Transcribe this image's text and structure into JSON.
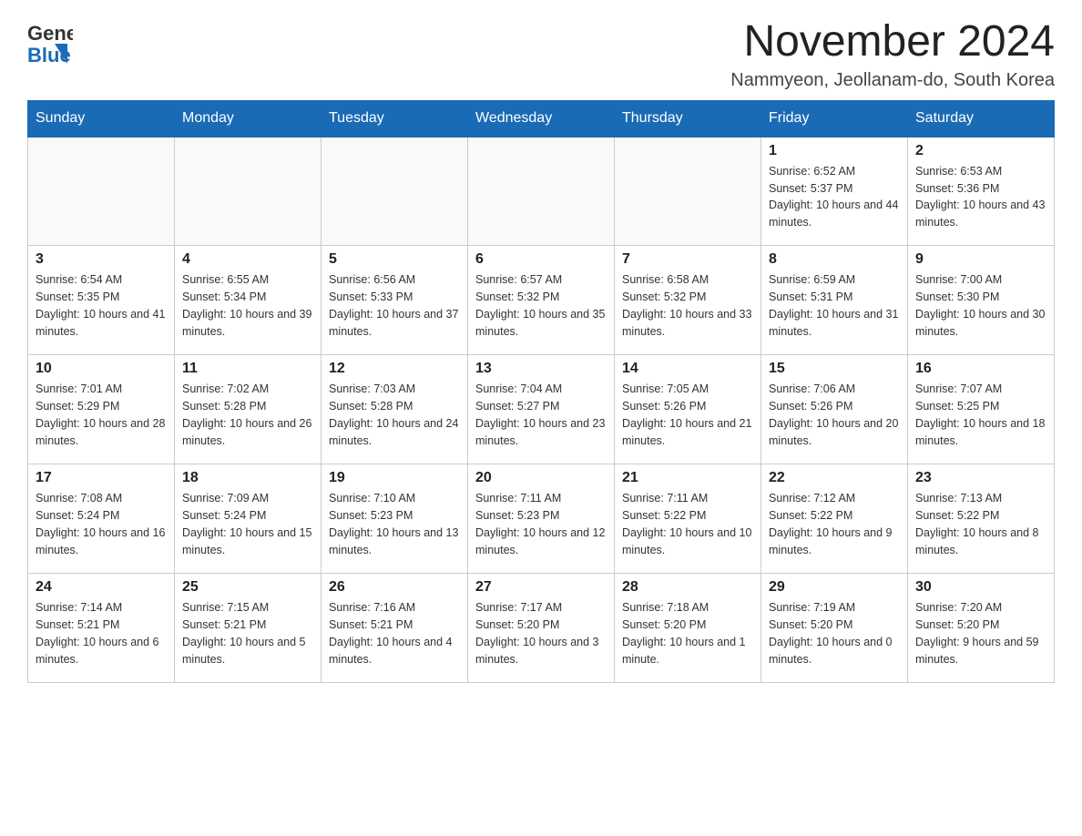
{
  "logo": {
    "general": "General",
    "blue": "Blue"
  },
  "header": {
    "month_title": "November 2024",
    "location": "Nammyeon, Jeollanam-do, South Korea"
  },
  "days_of_week": [
    "Sunday",
    "Monday",
    "Tuesday",
    "Wednesday",
    "Thursday",
    "Friday",
    "Saturday"
  ],
  "weeks": [
    [
      {
        "day": "",
        "info": ""
      },
      {
        "day": "",
        "info": ""
      },
      {
        "day": "",
        "info": ""
      },
      {
        "day": "",
        "info": ""
      },
      {
        "day": "",
        "info": ""
      },
      {
        "day": "1",
        "info": "Sunrise: 6:52 AM\nSunset: 5:37 PM\nDaylight: 10 hours and 44 minutes."
      },
      {
        "day": "2",
        "info": "Sunrise: 6:53 AM\nSunset: 5:36 PM\nDaylight: 10 hours and 43 minutes."
      }
    ],
    [
      {
        "day": "3",
        "info": "Sunrise: 6:54 AM\nSunset: 5:35 PM\nDaylight: 10 hours and 41 minutes."
      },
      {
        "day": "4",
        "info": "Sunrise: 6:55 AM\nSunset: 5:34 PM\nDaylight: 10 hours and 39 minutes."
      },
      {
        "day": "5",
        "info": "Sunrise: 6:56 AM\nSunset: 5:33 PM\nDaylight: 10 hours and 37 minutes."
      },
      {
        "day": "6",
        "info": "Sunrise: 6:57 AM\nSunset: 5:32 PM\nDaylight: 10 hours and 35 minutes."
      },
      {
        "day": "7",
        "info": "Sunrise: 6:58 AM\nSunset: 5:32 PM\nDaylight: 10 hours and 33 minutes."
      },
      {
        "day": "8",
        "info": "Sunrise: 6:59 AM\nSunset: 5:31 PM\nDaylight: 10 hours and 31 minutes."
      },
      {
        "day": "9",
        "info": "Sunrise: 7:00 AM\nSunset: 5:30 PM\nDaylight: 10 hours and 30 minutes."
      }
    ],
    [
      {
        "day": "10",
        "info": "Sunrise: 7:01 AM\nSunset: 5:29 PM\nDaylight: 10 hours and 28 minutes."
      },
      {
        "day": "11",
        "info": "Sunrise: 7:02 AM\nSunset: 5:28 PM\nDaylight: 10 hours and 26 minutes."
      },
      {
        "day": "12",
        "info": "Sunrise: 7:03 AM\nSunset: 5:28 PM\nDaylight: 10 hours and 24 minutes."
      },
      {
        "day": "13",
        "info": "Sunrise: 7:04 AM\nSunset: 5:27 PM\nDaylight: 10 hours and 23 minutes."
      },
      {
        "day": "14",
        "info": "Sunrise: 7:05 AM\nSunset: 5:26 PM\nDaylight: 10 hours and 21 minutes."
      },
      {
        "day": "15",
        "info": "Sunrise: 7:06 AM\nSunset: 5:26 PM\nDaylight: 10 hours and 20 minutes."
      },
      {
        "day": "16",
        "info": "Sunrise: 7:07 AM\nSunset: 5:25 PM\nDaylight: 10 hours and 18 minutes."
      }
    ],
    [
      {
        "day": "17",
        "info": "Sunrise: 7:08 AM\nSunset: 5:24 PM\nDaylight: 10 hours and 16 minutes."
      },
      {
        "day": "18",
        "info": "Sunrise: 7:09 AM\nSunset: 5:24 PM\nDaylight: 10 hours and 15 minutes."
      },
      {
        "day": "19",
        "info": "Sunrise: 7:10 AM\nSunset: 5:23 PM\nDaylight: 10 hours and 13 minutes."
      },
      {
        "day": "20",
        "info": "Sunrise: 7:11 AM\nSunset: 5:23 PM\nDaylight: 10 hours and 12 minutes."
      },
      {
        "day": "21",
        "info": "Sunrise: 7:11 AM\nSunset: 5:22 PM\nDaylight: 10 hours and 10 minutes."
      },
      {
        "day": "22",
        "info": "Sunrise: 7:12 AM\nSunset: 5:22 PM\nDaylight: 10 hours and 9 minutes."
      },
      {
        "day": "23",
        "info": "Sunrise: 7:13 AM\nSunset: 5:22 PM\nDaylight: 10 hours and 8 minutes."
      }
    ],
    [
      {
        "day": "24",
        "info": "Sunrise: 7:14 AM\nSunset: 5:21 PM\nDaylight: 10 hours and 6 minutes."
      },
      {
        "day": "25",
        "info": "Sunrise: 7:15 AM\nSunset: 5:21 PM\nDaylight: 10 hours and 5 minutes."
      },
      {
        "day": "26",
        "info": "Sunrise: 7:16 AM\nSunset: 5:21 PM\nDaylight: 10 hours and 4 minutes."
      },
      {
        "day": "27",
        "info": "Sunrise: 7:17 AM\nSunset: 5:20 PM\nDaylight: 10 hours and 3 minutes."
      },
      {
        "day": "28",
        "info": "Sunrise: 7:18 AM\nSunset: 5:20 PM\nDaylight: 10 hours and 1 minute."
      },
      {
        "day": "29",
        "info": "Sunrise: 7:19 AM\nSunset: 5:20 PM\nDaylight: 10 hours and 0 minutes."
      },
      {
        "day": "30",
        "info": "Sunrise: 7:20 AM\nSunset: 5:20 PM\nDaylight: 9 hours and 59 minutes."
      }
    ]
  ]
}
